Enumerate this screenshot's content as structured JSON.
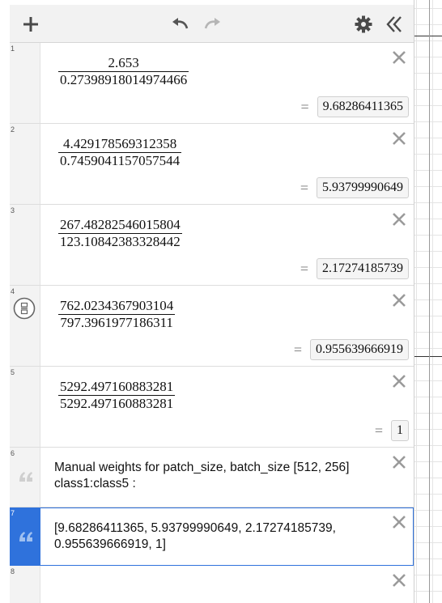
{
  "toolbar": {
    "add_icon": "plus-icon",
    "undo_icon": "undo-icon",
    "redo_icon": "redo-icon",
    "settings_icon": "gear-icon",
    "collapse_icon": "double-chevron-left-icon"
  },
  "expressions": [
    {
      "index": "1",
      "numerator": "2.653",
      "denominator": "0.27398918014974466",
      "result": "9.68286411365"
    },
    {
      "index": "2",
      "numerator": "4.429178569312358",
      "denominator": "0.7459041157057544",
      "result": "5.93799990649"
    },
    {
      "index": "3",
      "numerator": "267.48282546015804",
      "denominator": "123.10842383328442",
      "result": "2.17274185739"
    },
    {
      "index": "4",
      "numerator": "762.0234367903104",
      "denominator": "797.3961977186311",
      "result": "0.955639666919"
    },
    {
      "index": "5",
      "numerator": "5292.497160883281",
      "denominator": "5292.497160883281",
      "result": "1"
    }
  ],
  "notes": [
    {
      "index": "6",
      "text": "Manual weights for patch_size, batch_size [512, 256] class1:class5 :"
    },
    {
      "index": "7",
      "text": "[9.68286411365, 5.93799990649, 2.17274185739, 0.955639666919, 1]"
    }
  ],
  "empty_row": {
    "index": "8"
  },
  "colors": {
    "accent": "#2f72dc",
    "toolbar_bg": "#f2f2f2",
    "gutter_bg": "#f3f3f3"
  }
}
